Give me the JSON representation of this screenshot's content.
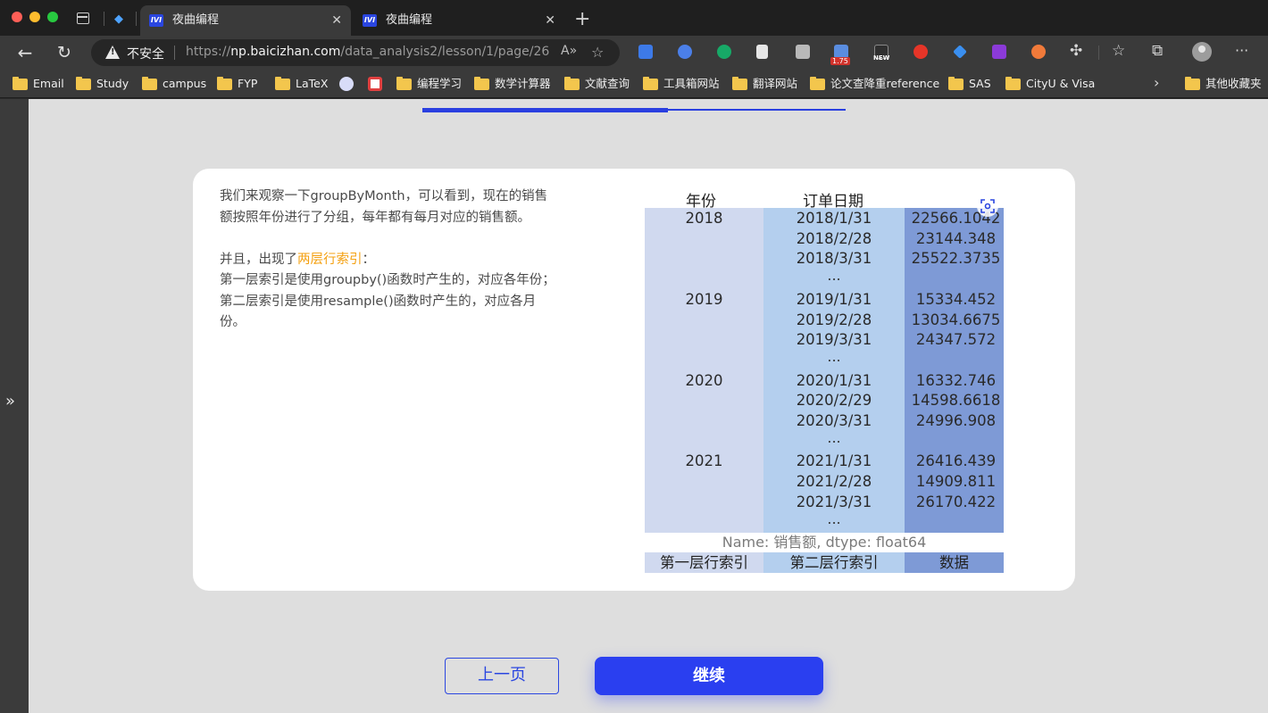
{
  "browser": {
    "pinned_tab_icon": "diamond-icon",
    "tabs": [
      {
        "title": "夜曲编程",
        "icon_text": "IVI",
        "active": true
      },
      {
        "title": "夜曲编程",
        "icon_text": "IVI",
        "active": false
      }
    ],
    "address": {
      "security_label": "不安全",
      "url_prefix": "https://",
      "url_host": "np.baicizhan.com",
      "url_path": "/data_analysis2/lesson/1/page/26"
    },
    "extension_badge": "1.75",
    "extension_new": "NEW",
    "bookmarks": [
      {
        "label": "Email",
        "type": "folder"
      },
      {
        "label": "Study",
        "type": "folder"
      },
      {
        "label": "campus",
        "type": "folder"
      },
      {
        "label": "FYP",
        "type": "folder"
      },
      {
        "label": "LaTeX",
        "type": "folder"
      },
      {
        "label": "编程学习",
        "type": "folder"
      },
      {
        "label": "数学计算器",
        "type": "folder"
      },
      {
        "label": "文献查询",
        "type": "folder"
      },
      {
        "label": "工具箱网站",
        "type": "folder"
      },
      {
        "label": "翻译网站",
        "type": "folder"
      },
      {
        "label": "论文查降重reference",
        "type": "folder"
      },
      {
        "label": "SAS",
        "type": "folder"
      },
      {
        "label": "CityU & Visa",
        "type": "folder"
      }
    ],
    "other_bookmarks": "其他收藏夹"
  },
  "lesson": {
    "progress": 0.58,
    "para1": "我们来观察一下groupByMonth，可以看到，现在的销售额按照年份进行了分组，每年都有每月对应的销售额。",
    "para2_prefix": "并且，出现了",
    "para2_highlight": "两层行索引",
    "para2_suffix": "：",
    "line_first": "第一层索引是使用groupby()函数时产生的，对应各年份；",
    "line_second": "第二层索引是使用resample()函数时产生的，对应各月份。",
    "table": {
      "header_year": "年份",
      "header_date": "订单日期",
      "groups": [
        {
          "year": "2018",
          "rows": [
            [
              "2018/1/31",
              "22566.1042"
            ],
            [
              "2018/2/28",
              "23144.348"
            ],
            [
              "2018/3/31",
              "25522.3735"
            ]
          ]
        },
        {
          "year": "2019",
          "rows": [
            [
              "2019/1/31",
              "15334.452"
            ],
            [
              "2019/2/28",
              "13034.6675"
            ],
            [
              "2019/3/31",
              "24347.572"
            ]
          ]
        },
        {
          "year": "2020",
          "rows": [
            [
              "2020/1/31",
              "16332.746"
            ],
            [
              "2020/2/29",
              "14598.6618"
            ],
            [
              "2020/3/31",
              "24996.908"
            ]
          ]
        },
        {
          "year": "2021",
          "rows": [
            [
              "2021/1/31",
              "26416.439"
            ],
            [
              "2021/2/28",
              "14909.811"
            ],
            [
              "2021/3/31",
              "26170.422"
            ]
          ]
        }
      ],
      "ellipsis": "...",
      "footer": "Name: 销售额, dtype: float64",
      "legend": [
        "第一层行索引",
        "第二层行索引",
        "数据"
      ],
      "colors": [
        "#d0d9ef",
        "#b4cfee",
        "#7e9ad6"
      ]
    },
    "prev_label": "上一页",
    "next_label": "继续",
    "accent": "#2a3ff0"
  }
}
